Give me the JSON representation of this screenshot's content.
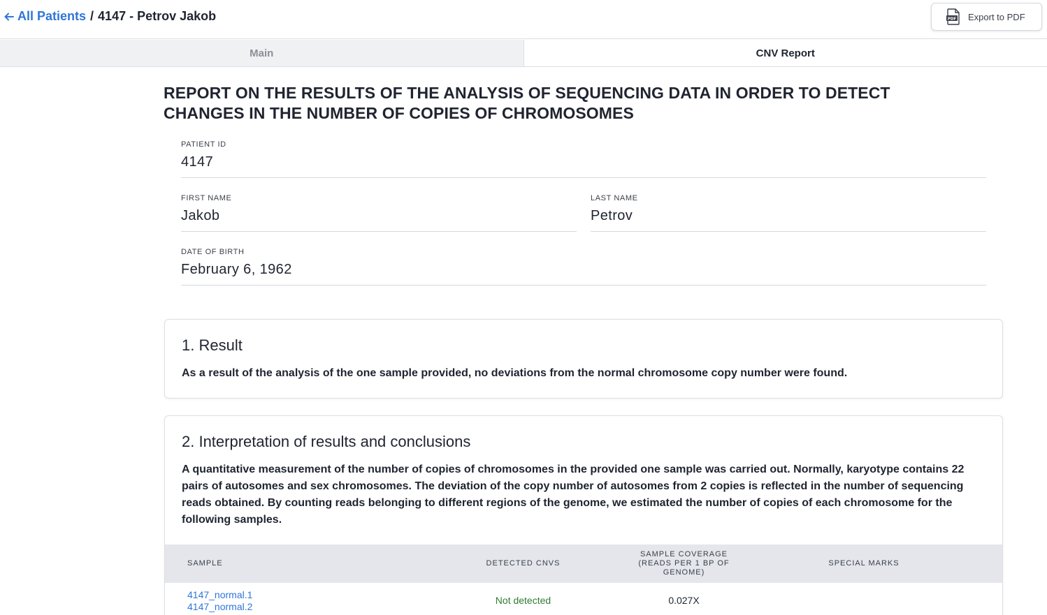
{
  "header": {
    "back_label": "All Patients",
    "separator": "/",
    "patient_title": "4147 - Petrov Jakob",
    "export_label": "Export to PDF"
  },
  "tabs": [
    {
      "label": "Main",
      "active": false
    },
    {
      "label": "CNV Report",
      "active": true
    }
  ],
  "report": {
    "title": "REPORT ON THE RESULTS OF THE ANALYSIS OF SEQUENCING DATA IN ORDER TO DETECT CHANGES IN THE NUMBER OF COPIES OF CHROMOSOMES",
    "fields": {
      "patient_id": {
        "label": "PATIENT ID",
        "value": "4147"
      },
      "first_name": {
        "label": "FIRST NAME",
        "value": "Jakob"
      },
      "last_name": {
        "label": "LAST NAME",
        "value": "Petrov"
      },
      "dob": {
        "label": "DATE OF BIRTH",
        "value": "February 6, 1962"
      }
    }
  },
  "result": {
    "heading": "1. Result",
    "text": "As a result of the analysis of the one sample provided, no deviations from the normal chromosome copy number were found."
  },
  "interpretation": {
    "heading": "2. Interpretation of results and conclusions",
    "text": "A quantitative measurement of the number of copies of chromosomes in the provided one sample was carried out. Normally, karyotype contains 22 pairs of autosomes and sex chromosomes. The deviation of the copy number of autosomes from 2 copies is reflected in the number of sequencing reads obtained. By counting reads belonging to different regions of the genome, we estimated the number of copies of each chromosome for the following samples.",
    "table": {
      "headers": {
        "sample": "SAMPLE",
        "detected": "DETECTED CNVS",
        "coverage": "SAMPLE COVERAGE (READS PER 1 BP OF GENOME)",
        "marks": "SPECIAL MARKS"
      },
      "rows": [
        {
          "samples": [
            "4147_normal.1",
            "4147_normal.2"
          ],
          "detected": "Not detected",
          "coverage": "0.027X",
          "marks": ""
        }
      ]
    }
  },
  "colors": {
    "accent": "#2f76d8",
    "success": "#2e7d32",
    "table_header_bg": "#e4e6ec"
  }
}
